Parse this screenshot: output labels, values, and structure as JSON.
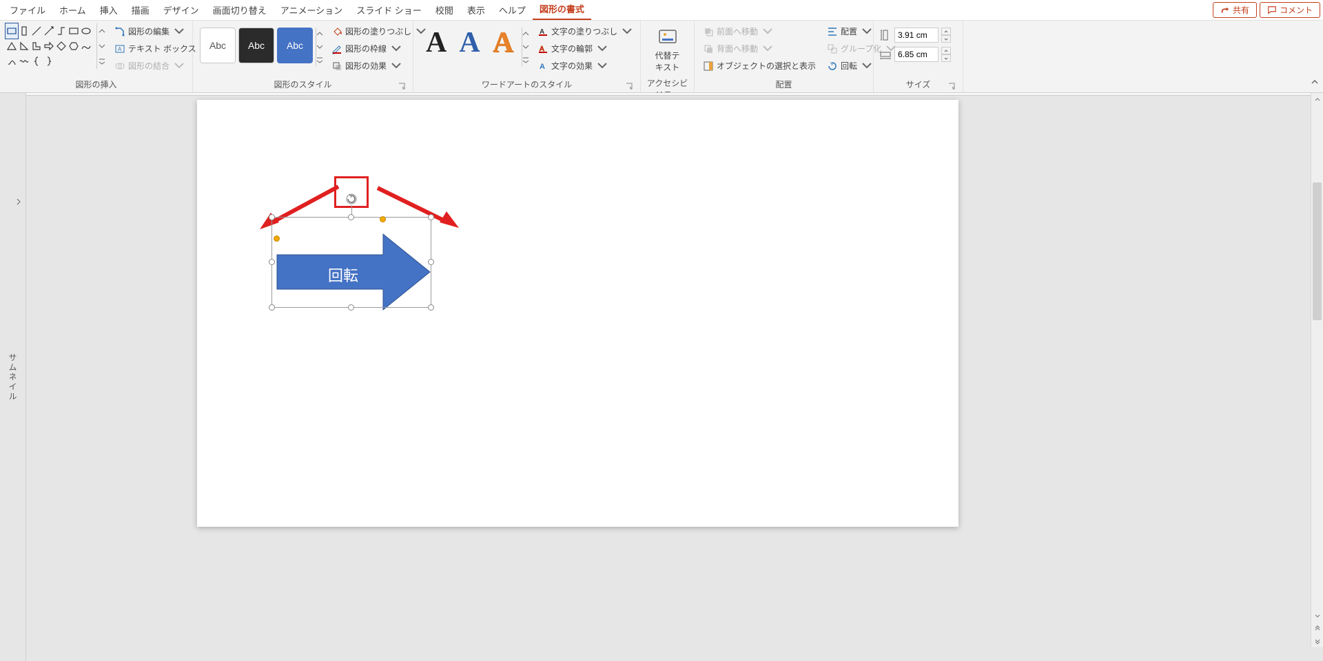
{
  "tabs": {
    "file": "ファイル",
    "home": "ホーム",
    "insert": "挿入",
    "draw": "描画",
    "design": "デザイン",
    "transition": "画面切り替え",
    "animation": "アニメーション",
    "slideshow": "スライド ショー",
    "review": "校閲",
    "view": "表示",
    "help": "ヘルプ",
    "shapeformat": "図形の書式"
  },
  "topRight": {
    "share": "共有",
    "comment": "コメント"
  },
  "groups": {
    "insertShapes": "図形の挿入",
    "shapeStyles": "図形のスタイル",
    "wordArtStyles": "ワードアートのスタイル",
    "accessibility": "アクセシビリティ",
    "arrange": "配置",
    "size": "サイズ"
  },
  "insertShapes": {
    "editShape": "図形の編集",
    "textBox": "テキスト ボックス",
    "mergeShapes": "図形の結合"
  },
  "shapeStyles": {
    "swatch": "Abc",
    "fill": "図形の塗りつぶし",
    "outline": "図形の枠線",
    "effects": "図形の効果"
  },
  "wordArt": {
    "glyph": "A",
    "textFill": "文字の塗りつぶし",
    "textOutline": "文字の輪郭",
    "textEffects": "文字の効果"
  },
  "accessibility": {
    "altText": "代替テキスト"
  },
  "arrange": {
    "bringForward": "前面へ移動",
    "sendBackward": "背面へ移動",
    "selectionPane": "オブジェクトの選択と表示",
    "align": "配置",
    "group": "グループ化",
    "rotate": "回転"
  },
  "size": {
    "height": "3.91 cm",
    "width": "6.85 cm"
  },
  "thumbnails": {
    "label": "サムネイル"
  },
  "shape": {
    "text": "回転"
  }
}
